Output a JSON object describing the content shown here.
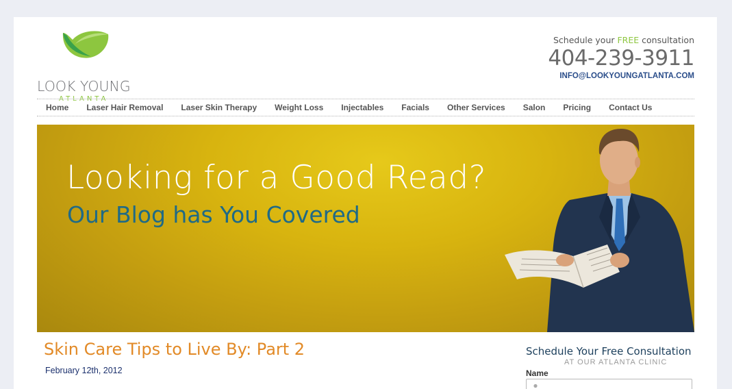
{
  "logo": {
    "main": "LOOK YOUNG",
    "sub": "ATLANTA",
    "icon": "leaf-icon",
    "leaf_colors": [
      "#8dc63f",
      "#2e9a46"
    ]
  },
  "contact": {
    "schedule_prefix": "Schedule your ",
    "schedule_free": "FREE",
    "schedule_suffix": " consultation",
    "phone": "404-239-3911",
    "email": "INFO@LOOKYOUNGATLANTA.COM"
  },
  "nav": {
    "items": [
      {
        "label": "Home"
      },
      {
        "label": "Laser Hair Removal"
      },
      {
        "label": "Laser Skin Therapy"
      },
      {
        "label": "Weight Loss"
      },
      {
        "label": "Injectables"
      },
      {
        "label": "Facials"
      },
      {
        "label": "Other Services"
      },
      {
        "label": "Salon"
      },
      {
        "label": "Pricing"
      },
      {
        "label": "Contact Us"
      }
    ]
  },
  "banner": {
    "headline": "Looking for a Good Read?",
    "subheadline": "Our Blog has You Covered",
    "image": "man-reading-newspaper"
  },
  "post": {
    "title": "Skin Care Tips to Live By: Part 2",
    "date": "February 12th, 2012"
  },
  "sidebar": {
    "title": "Schedule Your Free Consultation",
    "subtitle": "AT OUR ATLANTA CLINIC",
    "name_label": "Name",
    "name_icon": "person-icon"
  },
  "colors": {
    "accent_green": "#8dc63f",
    "title_orange": "#e28a27",
    "link_blue": "#2a4d8a",
    "banner_gold": "#d8b40f",
    "banner_teal": "#1f6a86"
  }
}
